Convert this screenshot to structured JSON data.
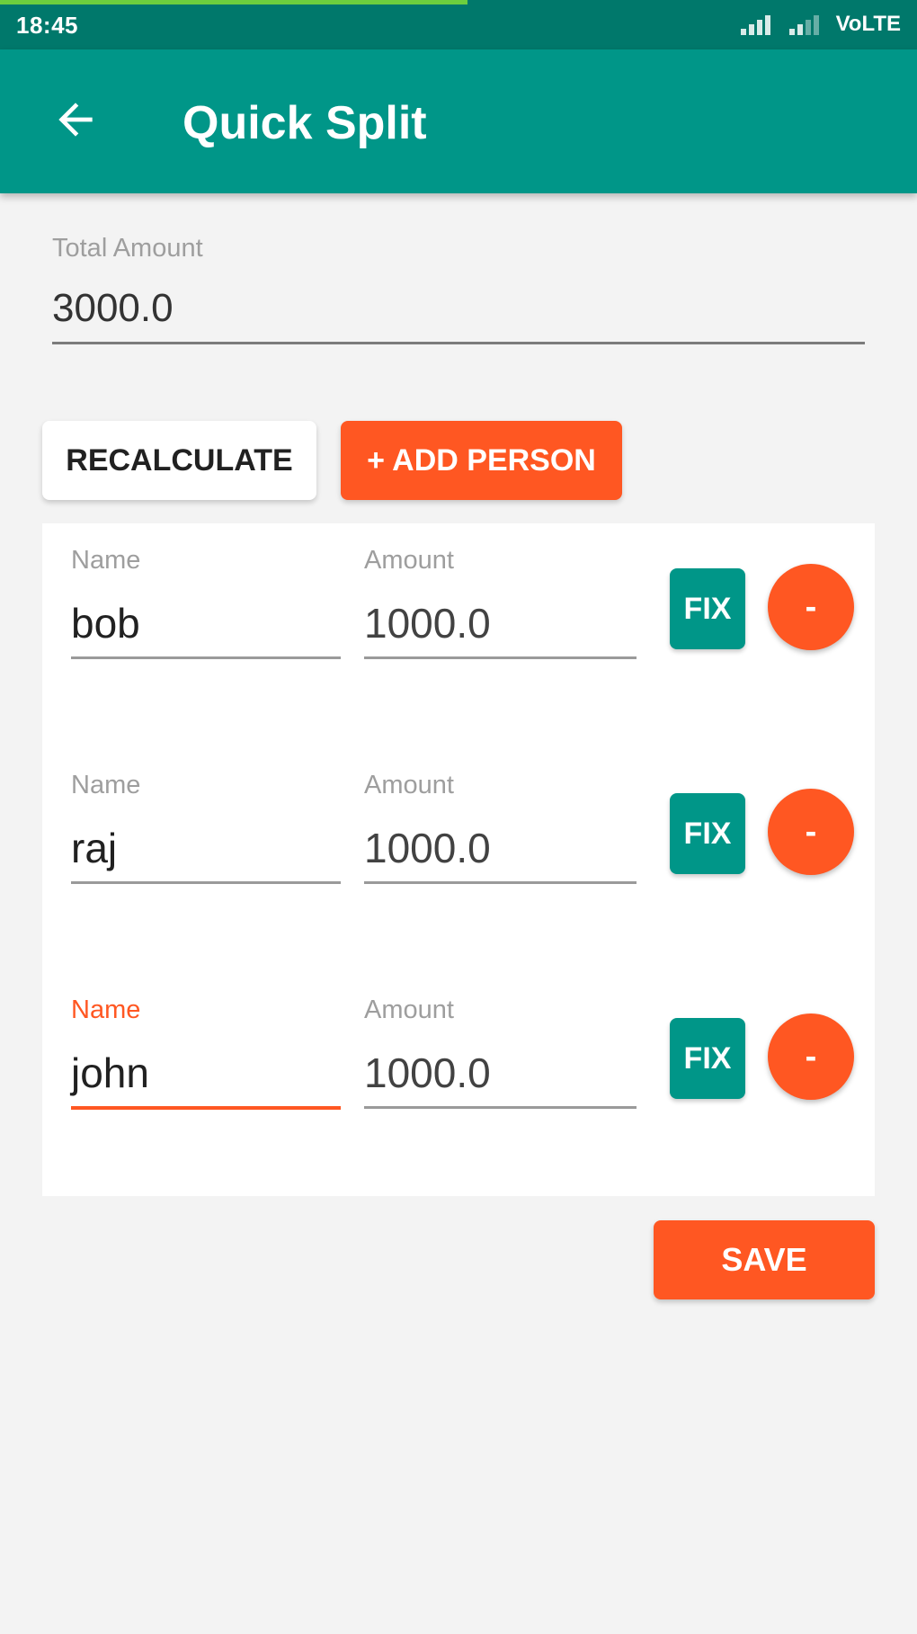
{
  "status_bar": {
    "time": "18:45",
    "network": "VoLTE",
    "progress_fraction": 0.51,
    "icons": [
      "signal-icon",
      "signal-weak-icon"
    ]
  },
  "app_bar": {
    "title": "Quick Split",
    "back_icon": "arrow-left-icon"
  },
  "total": {
    "label": "Total Amount",
    "value": "3000.0"
  },
  "actions": {
    "recalculate_label": "RECALCULATE",
    "add_person_label": "+ ADD PERSON"
  },
  "people": [
    {
      "name_label": "Name",
      "name": "bob",
      "amount_label": "Amount",
      "amount": "1000.0",
      "fix_label": "FIX",
      "remove_label": "-"
    },
    {
      "name_label": "Name",
      "name": "raj",
      "amount_label": "Amount",
      "amount": "1000.0",
      "fix_label": "FIX",
      "remove_label": "-"
    },
    {
      "name_label": "Name",
      "name": "john",
      "amount_label": "Amount",
      "amount": "1000.0",
      "fix_label": "FIX",
      "remove_label": "-"
    }
  ],
  "save_label": "SAVE",
  "colors": {
    "primary": "#009688",
    "primary_dark": "#00786b",
    "accent": "#ff5722",
    "background": "#f3f3f3"
  }
}
